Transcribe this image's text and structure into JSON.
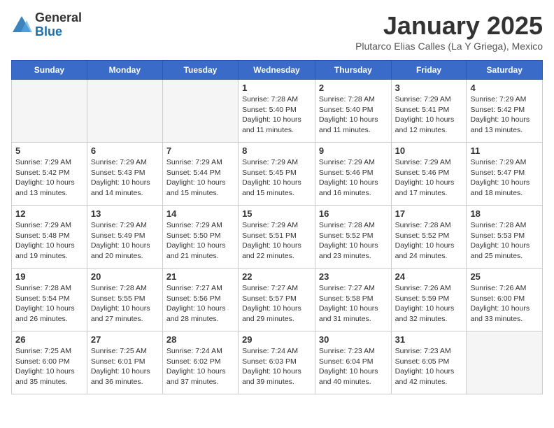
{
  "logo": {
    "general": "General",
    "blue": "Blue"
  },
  "title": "January 2025",
  "subtitle": "Plutarco Elias Calles (La Y Griega), Mexico",
  "days_of_week": [
    "Sunday",
    "Monday",
    "Tuesday",
    "Wednesday",
    "Thursday",
    "Friday",
    "Saturday"
  ],
  "weeks": [
    [
      {
        "day": "",
        "info": ""
      },
      {
        "day": "",
        "info": ""
      },
      {
        "day": "",
        "info": ""
      },
      {
        "day": "1",
        "info": "Sunrise: 7:28 AM\nSunset: 5:40 PM\nDaylight: 10 hours\nand 11 minutes."
      },
      {
        "day": "2",
        "info": "Sunrise: 7:28 AM\nSunset: 5:40 PM\nDaylight: 10 hours\nand 11 minutes."
      },
      {
        "day": "3",
        "info": "Sunrise: 7:29 AM\nSunset: 5:41 PM\nDaylight: 10 hours\nand 12 minutes."
      },
      {
        "day": "4",
        "info": "Sunrise: 7:29 AM\nSunset: 5:42 PM\nDaylight: 10 hours\nand 13 minutes."
      }
    ],
    [
      {
        "day": "5",
        "info": "Sunrise: 7:29 AM\nSunset: 5:42 PM\nDaylight: 10 hours\nand 13 minutes."
      },
      {
        "day": "6",
        "info": "Sunrise: 7:29 AM\nSunset: 5:43 PM\nDaylight: 10 hours\nand 14 minutes."
      },
      {
        "day": "7",
        "info": "Sunrise: 7:29 AM\nSunset: 5:44 PM\nDaylight: 10 hours\nand 15 minutes."
      },
      {
        "day": "8",
        "info": "Sunrise: 7:29 AM\nSunset: 5:45 PM\nDaylight: 10 hours\nand 15 minutes."
      },
      {
        "day": "9",
        "info": "Sunrise: 7:29 AM\nSunset: 5:46 PM\nDaylight: 10 hours\nand 16 minutes."
      },
      {
        "day": "10",
        "info": "Sunrise: 7:29 AM\nSunset: 5:46 PM\nDaylight: 10 hours\nand 17 minutes."
      },
      {
        "day": "11",
        "info": "Sunrise: 7:29 AM\nSunset: 5:47 PM\nDaylight: 10 hours\nand 18 minutes."
      }
    ],
    [
      {
        "day": "12",
        "info": "Sunrise: 7:29 AM\nSunset: 5:48 PM\nDaylight: 10 hours\nand 19 minutes."
      },
      {
        "day": "13",
        "info": "Sunrise: 7:29 AM\nSunset: 5:49 PM\nDaylight: 10 hours\nand 20 minutes."
      },
      {
        "day": "14",
        "info": "Sunrise: 7:29 AM\nSunset: 5:50 PM\nDaylight: 10 hours\nand 21 minutes."
      },
      {
        "day": "15",
        "info": "Sunrise: 7:29 AM\nSunset: 5:51 PM\nDaylight: 10 hours\nand 22 minutes."
      },
      {
        "day": "16",
        "info": "Sunrise: 7:28 AM\nSunset: 5:52 PM\nDaylight: 10 hours\nand 23 minutes."
      },
      {
        "day": "17",
        "info": "Sunrise: 7:28 AM\nSunset: 5:52 PM\nDaylight: 10 hours\nand 24 minutes."
      },
      {
        "day": "18",
        "info": "Sunrise: 7:28 AM\nSunset: 5:53 PM\nDaylight: 10 hours\nand 25 minutes."
      }
    ],
    [
      {
        "day": "19",
        "info": "Sunrise: 7:28 AM\nSunset: 5:54 PM\nDaylight: 10 hours\nand 26 minutes."
      },
      {
        "day": "20",
        "info": "Sunrise: 7:28 AM\nSunset: 5:55 PM\nDaylight: 10 hours\nand 27 minutes."
      },
      {
        "day": "21",
        "info": "Sunrise: 7:27 AM\nSunset: 5:56 PM\nDaylight: 10 hours\nand 28 minutes."
      },
      {
        "day": "22",
        "info": "Sunrise: 7:27 AM\nSunset: 5:57 PM\nDaylight: 10 hours\nand 29 minutes."
      },
      {
        "day": "23",
        "info": "Sunrise: 7:27 AM\nSunset: 5:58 PM\nDaylight: 10 hours\nand 31 minutes."
      },
      {
        "day": "24",
        "info": "Sunrise: 7:26 AM\nSunset: 5:59 PM\nDaylight: 10 hours\nand 32 minutes."
      },
      {
        "day": "25",
        "info": "Sunrise: 7:26 AM\nSunset: 6:00 PM\nDaylight: 10 hours\nand 33 minutes."
      }
    ],
    [
      {
        "day": "26",
        "info": "Sunrise: 7:25 AM\nSunset: 6:00 PM\nDaylight: 10 hours\nand 35 minutes."
      },
      {
        "day": "27",
        "info": "Sunrise: 7:25 AM\nSunset: 6:01 PM\nDaylight: 10 hours\nand 36 minutes."
      },
      {
        "day": "28",
        "info": "Sunrise: 7:24 AM\nSunset: 6:02 PM\nDaylight: 10 hours\nand 37 minutes."
      },
      {
        "day": "29",
        "info": "Sunrise: 7:24 AM\nSunset: 6:03 PM\nDaylight: 10 hours\nand 39 minutes."
      },
      {
        "day": "30",
        "info": "Sunrise: 7:23 AM\nSunset: 6:04 PM\nDaylight: 10 hours\nand 40 minutes."
      },
      {
        "day": "31",
        "info": "Sunrise: 7:23 AM\nSunset: 6:05 PM\nDaylight: 10 hours\nand 42 minutes."
      },
      {
        "day": "",
        "info": ""
      }
    ]
  ]
}
